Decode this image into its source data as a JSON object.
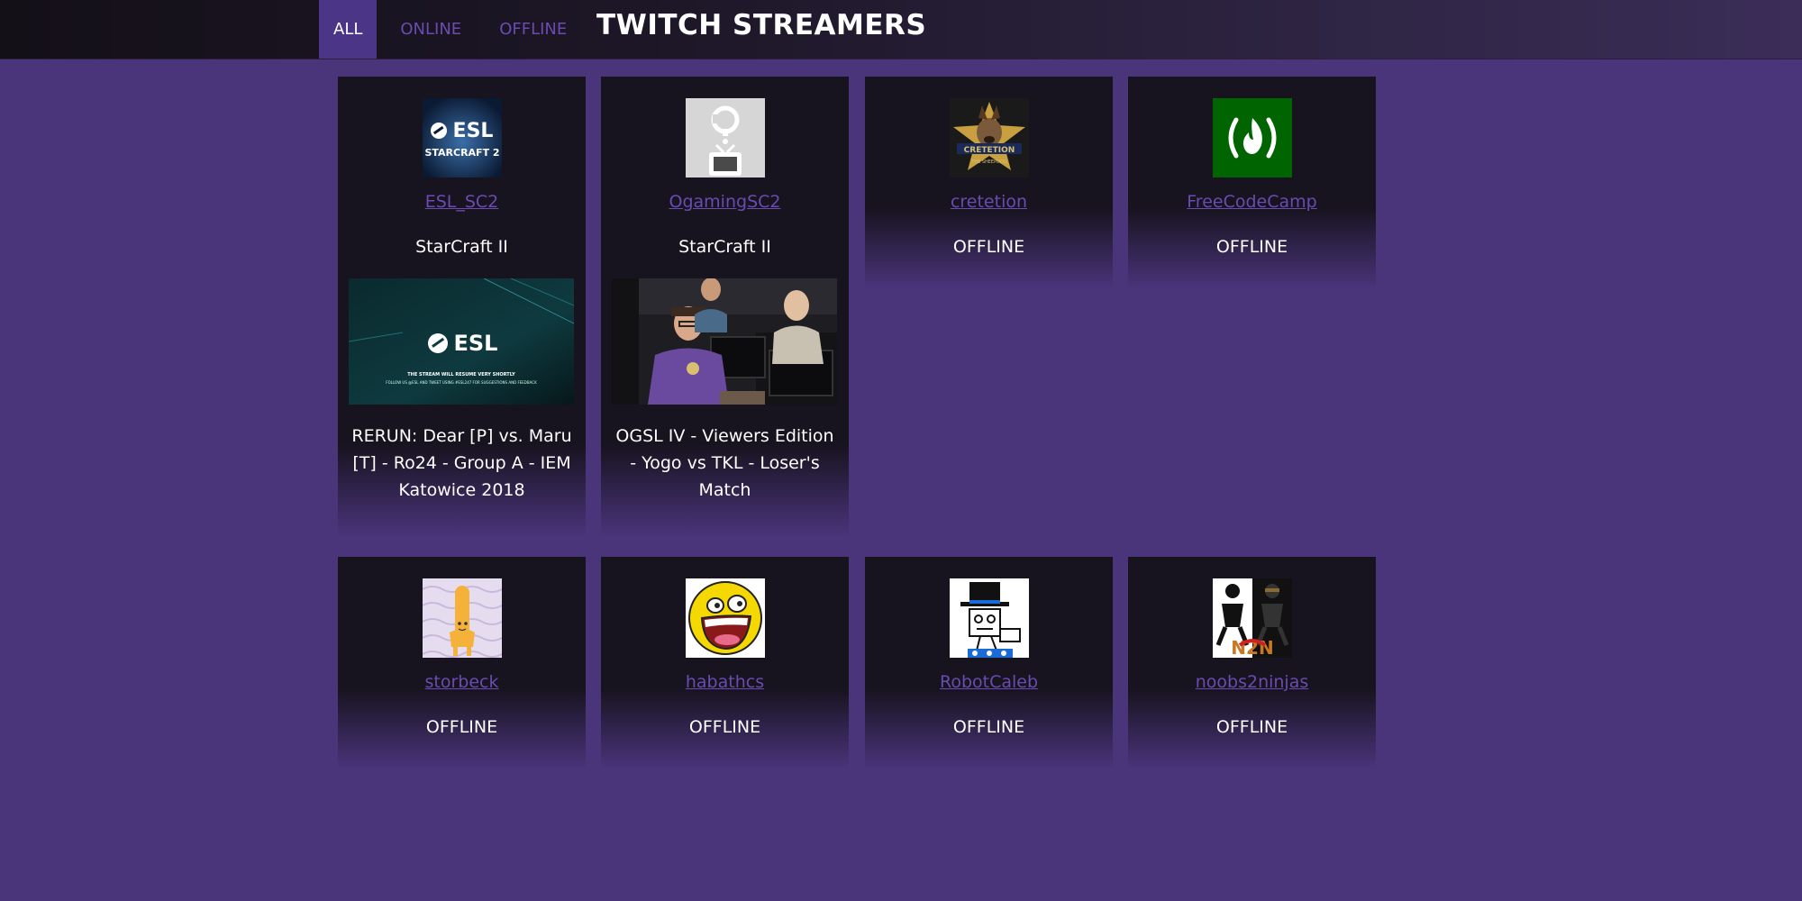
{
  "nav": {
    "tabs": [
      {
        "label": "ALL",
        "active": true
      },
      {
        "label": "ONLINE",
        "active": false
      },
      {
        "label": "OFFLINE",
        "active": false
      }
    ]
  },
  "app_title": "TWITCH STREAMERS",
  "colors": {
    "page_background": "#4a347a",
    "card_background": "#17131f",
    "link": "#6a4bb0",
    "active_tab": "#4b3587"
  },
  "streamers": [
    {
      "name": "ESL_SC2",
      "status": "StarCraft II",
      "online": true,
      "stream_title": "RERUN: Dear [P] vs. Maru [T] - Ro24 - Group A - IEM Katowice 2018",
      "avatar_text": [
        "ESL",
        "STARCRAFT 2"
      ],
      "preview_text": [
        "ESL",
        "THE STREAM WILL RESUME VERY SHORTLY",
        "FOLLOW US @ESL AND TWEET USING #ESL247 FOR SUGGESTIONS AND FEEDBACK"
      ]
    },
    {
      "name": "OgamingSC2",
      "status": "StarCraft II",
      "online": true,
      "stream_title": "OGSL IV - Viewers Edition - Yogo vs TKL - Loser's Match"
    },
    {
      "name": "cretetion",
      "status": "OFFLINE",
      "online": false,
      "avatar_text": [
        "CRETETION",
        "THE SHEEPDOG"
      ]
    },
    {
      "name": "FreeCodeCamp",
      "status": "OFFLINE",
      "online": false
    },
    {
      "name": "storbeck",
      "status": "OFFLINE",
      "online": false
    },
    {
      "name": "habathcs",
      "status": "OFFLINE",
      "online": false
    },
    {
      "name": "RobotCaleb",
      "status": "OFFLINE",
      "online": false
    },
    {
      "name": "noobs2ninjas",
      "status": "OFFLINE",
      "online": false,
      "avatar_text": [
        "N2N"
      ]
    }
  ]
}
